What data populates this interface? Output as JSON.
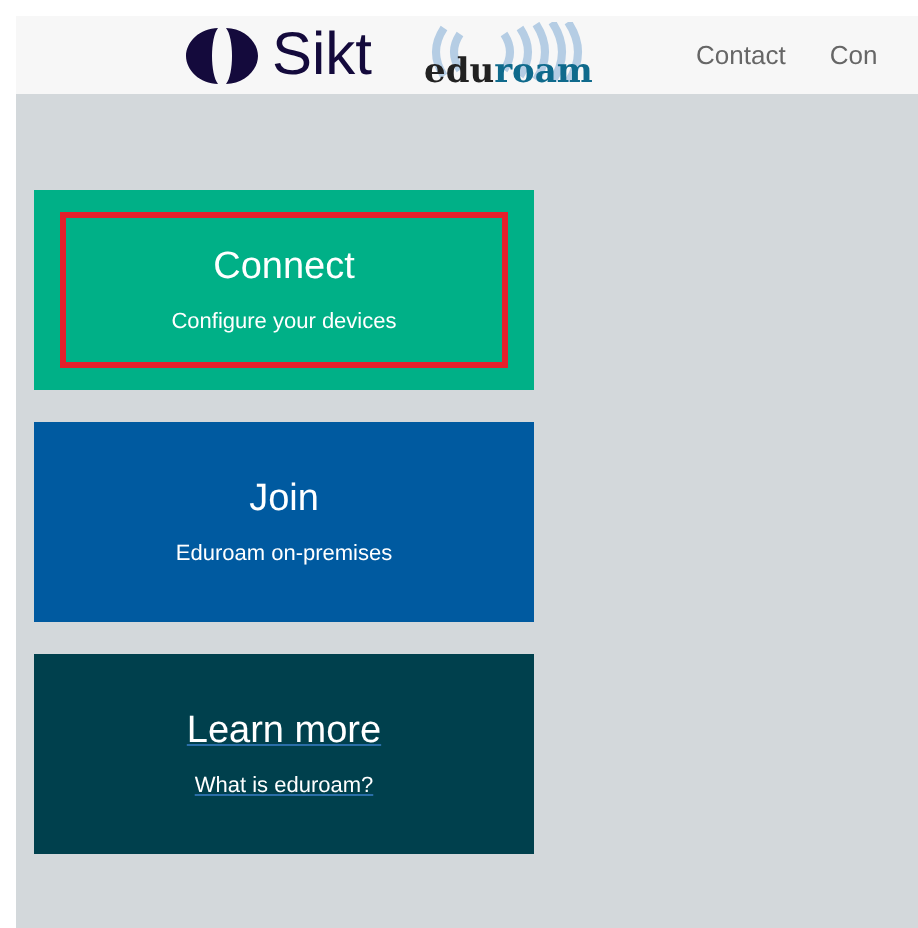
{
  "header": {
    "brand": "Sikt",
    "partner_logo": {
      "text_dark": "edu",
      "text_blue": "roam"
    },
    "nav": [
      {
        "label": "Contact"
      },
      {
        "label": "Con"
      }
    ]
  },
  "cards": [
    {
      "title": "Connect",
      "subtitle": "Configure your devices",
      "color": "#00b087",
      "underlined": false,
      "highlighted": true
    },
    {
      "title": "Join",
      "subtitle": "Eduroam on-premises",
      "color": "#005aa0",
      "underlined": false,
      "highlighted": false
    },
    {
      "title": "Learn more",
      "subtitle": "What is eduroam?",
      "color": "#00404d",
      "underlined": true,
      "highlighted": false
    }
  ]
}
